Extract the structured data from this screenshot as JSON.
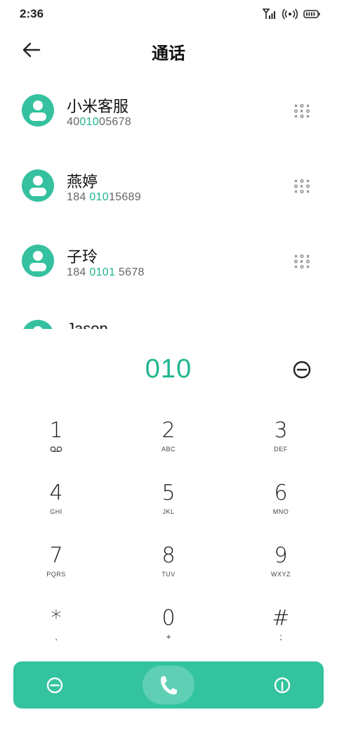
{
  "status_bar": {
    "time": "2:36"
  },
  "header": {
    "title": "通话"
  },
  "contacts": [
    {
      "name": "小米客服",
      "number_pre": "40",
      "number_hl": "010",
      "number_post": "05678"
    },
    {
      "name": "燕婷",
      "number_pre": "184 ",
      "number_hl": "010",
      "number_post": "15689"
    },
    {
      "name": "子玲",
      "number_pre": "184 ",
      "number_hl": "0101",
      "number_post": " 5678"
    },
    {
      "name": "Jason",
      "number_pre": "",
      "number_hl": "",
      "number_post": ""
    }
  ],
  "dialer": {
    "input": "010"
  },
  "keypad": [
    {
      "digit": "1",
      "letters": "",
      "icon": "voicemail-icon"
    },
    {
      "digit": "2",
      "letters": "ABC"
    },
    {
      "digit": "3",
      "letters": "DEF"
    },
    {
      "digit": "4",
      "letters": "GHI"
    },
    {
      "digit": "5",
      "letters": "JKL"
    },
    {
      "digit": "6",
      "letters": "MNO"
    },
    {
      "digit": "7",
      "letters": "PQRS"
    },
    {
      "digit": "8",
      "letters": "TUV"
    },
    {
      "digit": "9",
      "letters": "WXYZ"
    },
    {
      "digit": "*",
      "letters": ","
    },
    {
      "digit": "0",
      "letters": "+"
    },
    {
      "digit": "#",
      "letters": ";"
    }
  ],
  "colors": {
    "accent": "#35c19f",
    "highlight": "#1fb590",
    "bar": "#33c39f"
  },
  "icons": {
    "back": "arrow-left-icon",
    "detail": "contact-detail-icon",
    "backspace": "backspace-icon",
    "call": "phone-icon",
    "left_action": "hide-keypad-icon",
    "right_action": "dial-option-icon"
  }
}
